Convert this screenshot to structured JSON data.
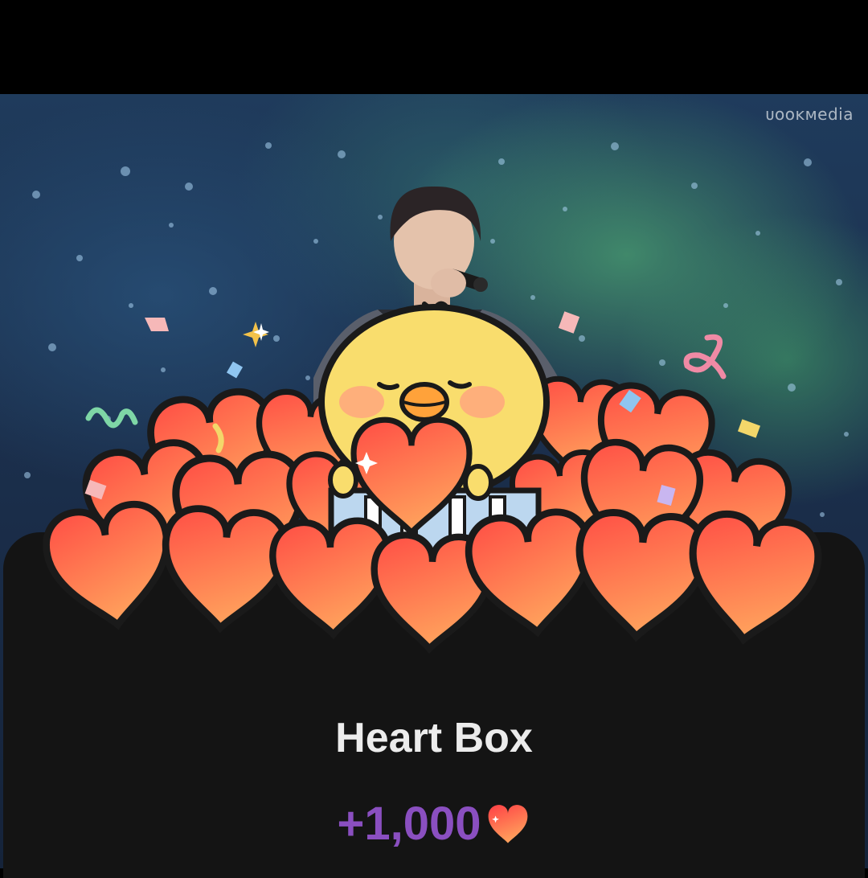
{
  "background": {
    "watermark": "ᴜᴏᴏᴋᴍedia",
    "photo": "singer-on-stage-with-microphone"
  },
  "reward_popup": {
    "title": "Heart Box",
    "amount": "+1,000",
    "amount_color": "#8a4fc0",
    "amount_icon": "heart-icon",
    "illustration": "yellow-chick-holding-heart-in-pile-of-hearts",
    "colors": {
      "heart_top": "#ff5a48",
      "heart_bottom": "#ff9a5c",
      "chick": "#f9dd6d",
      "sheet_background": "#141414"
    }
  }
}
